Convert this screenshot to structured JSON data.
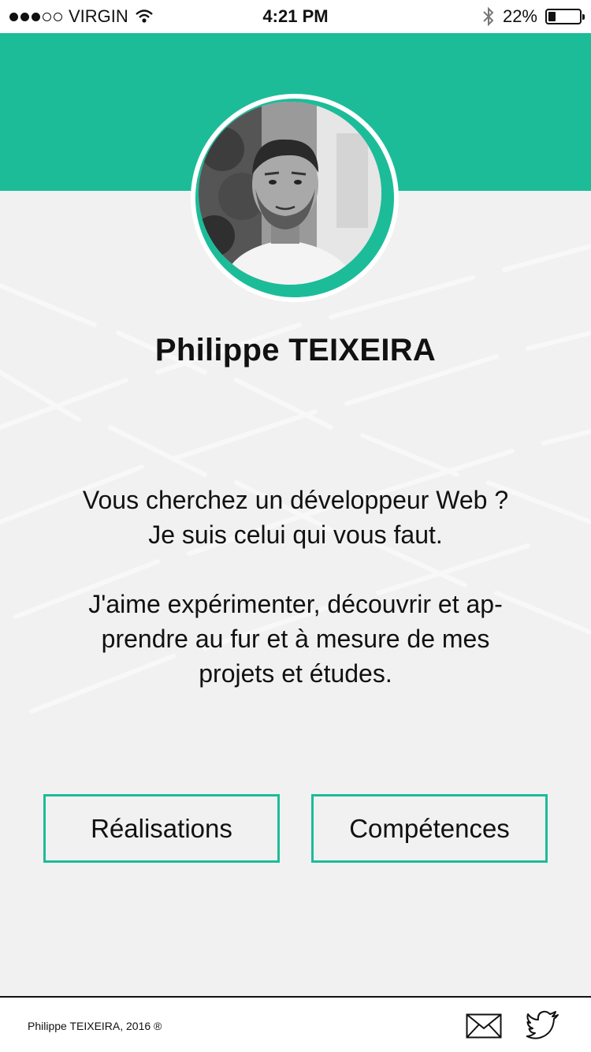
{
  "status_bar": {
    "carrier": "VIRGIN",
    "time": "4:21 PM",
    "battery": "22%",
    "battery_level": 0.22,
    "signal_bars_filled": 3,
    "signal_bars_total": 5,
    "icons": [
      "wifi-icon",
      "bluetooth-icon",
      "battery-icon"
    ]
  },
  "profile": {
    "name": "Philippe TEIXEIRA",
    "intro_line1": "Vous cherchez un développeur Web ?",
    "intro_line2": "Je suis celui qui vous faut.",
    "intro_line3": "J'aime expérimenter, découvrir et ap-",
    "intro_line4": "prendre au fur et à mesure de mes",
    "intro_line5": "projets et études."
  },
  "buttons": {
    "realisations": "Réalisations",
    "competences": "Compétences"
  },
  "footer": {
    "copyright": "Philippe TEIXEIRA, 2016 ®",
    "icons": [
      "mail-icon",
      "twitter-icon"
    ]
  },
  "colors": {
    "accent": "#1cbc99",
    "background": "#f1f1f1",
    "text": "#111111"
  }
}
